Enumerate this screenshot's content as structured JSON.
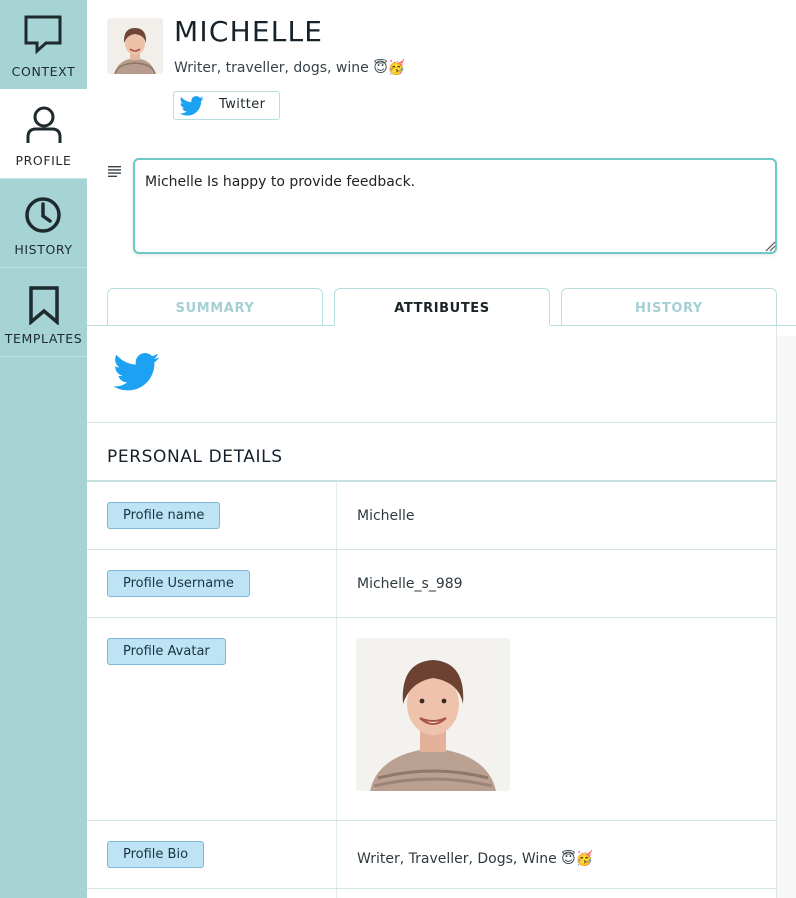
{
  "sidebar": {
    "items": [
      {
        "label": "CONTEXT",
        "icon": "speech-bubble-icon"
      },
      {
        "label": "PROFILE",
        "icon": "person-icon",
        "active": true
      },
      {
        "label": "HISTORY",
        "icon": "clock-icon"
      },
      {
        "label": "TEMPLATES",
        "icon": "bookmark-icon"
      }
    ]
  },
  "profile": {
    "name": "MICHELLE",
    "bio": "Writer, traveller, dogs, wine 😇🥳",
    "network_button": "Twitter",
    "note": "Michelle Is happy to provide feedback."
  },
  "tabs": [
    {
      "label": "SUMMARY",
      "active": false
    },
    {
      "label": "ATTRIBUTES",
      "active": true
    },
    {
      "label": "HISTORY",
      "active": false
    }
  ],
  "attributes": {
    "section_title": "PERSONAL DETAILS",
    "rows": [
      {
        "label": "Profile name",
        "value": "Michelle"
      },
      {
        "label": "Profile Username",
        "value": "Michelle_s_989"
      },
      {
        "label": "Profile Avatar",
        "value": ""
      },
      {
        "label": "Profile Bio",
        "value": "Writer, Traveller, Dogs, Wine 😇🥳"
      }
    ]
  },
  "colors": {
    "sidebar_bg": "#a6d3d3",
    "accent_teal": "#6dc9c4",
    "chip_bg": "#bde3f4",
    "twitter_blue": "#1da1f2"
  }
}
